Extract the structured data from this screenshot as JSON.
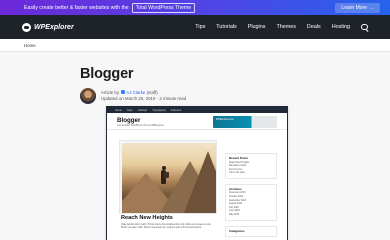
{
  "promo": {
    "text": "Easily create better & faster websites with the",
    "link": "Total WordPress Theme",
    "cta": "Learn More",
    "cta_icon": "→"
  },
  "nav": {
    "logo": "WPExplorer",
    "items": [
      "Tips",
      "Tutorials",
      "Plugins",
      "Themes",
      "Deals",
      "Hosting"
    ]
  },
  "breadcrumb": "Home",
  "page": {
    "title": "Blogger",
    "meta_prefix": "Article by",
    "author": "AJ Clarke",
    "author_suffix": "(staff)",
    "updated": "Updated on March 20, 2019 · 2 minute read"
  },
  "screenshot": {
    "topbar": [
      "Home",
      "Style",
      "Lifestyle",
      "Typography",
      "Features"
    ],
    "title": "Blogger",
    "description": "Just another WordPress Theme.WPExplorer",
    "ad_text": "WPExplorer.com",
    "post_title": "Reach New Heights",
    "post_excerpt": "Vitae iaculis dolor morbi. Primis lorem dui condimentum nisl mollis vel congue ut erat. Morbi vel quam nibh. Donec accumsan at, torquent quis orbi dui elementum.",
    "widgets": [
      {
        "title": "Recent Posts",
        "items": [
          "Reach New Heights",
          "Mountains Views",
          "Summer Fun",
          "Trip to the Lake"
        ]
      },
      {
        "title": "Archives",
        "items": [
          "November 2016",
          "October 2016",
          "September 2016",
          "August 2016",
          "July 2016",
          "June 2016",
          "May 2016"
        ]
      },
      {
        "title": "Categories",
        "items": []
      }
    ]
  }
}
